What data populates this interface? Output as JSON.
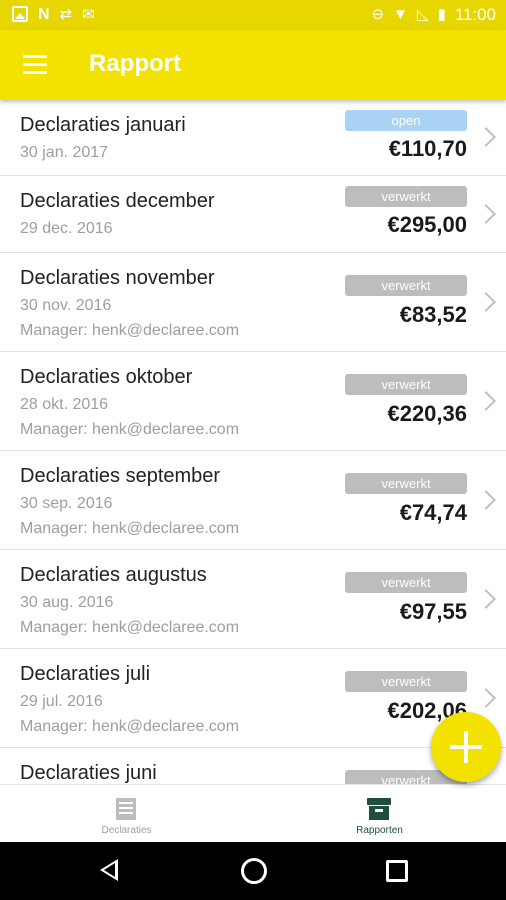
{
  "status_bar": {
    "time": "11:00",
    "left_icons": [
      "image-icon",
      "n-icon",
      "usb-icon",
      "mail-icon"
    ],
    "right_icons": [
      "dnd-icon",
      "wifi-icon",
      "no-signal-icon",
      "battery-icon"
    ]
  },
  "app_bar": {
    "title": "Rapport",
    "background": "#f3e200"
  },
  "reports": [
    {
      "title": "Declaraties januari",
      "date": "30 jan. 2017",
      "manager": "",
      "status": "open",
      "amount": "€110,70"
    },
    {
      "title": "Declaraties december",
      "date": "29 dec. 2016",
      "manager": "",
      "status": "verwerkt",
      "amount": "€295,00"
    },
    {
      "title": "Declaraties november",
      "date": "30 nov. 2016",
      "manager": "Manager: henk@declaree.com",
      "status": "verwerkt",
      "amount": "€83,52"
    },
    {
      "title": "Declaraties oktober",
      "date": "28 okt. 2016",
      "manager": "Manager: henk@declaree.com",
      "status": "verwerkt",
      "amount": "€220,36"
    },
    {
      "title": "Declaraties september",
      "date": "30 sep. 2016",
      "manager": "Manager: henk@declaree.com",
      "status": "verwerkt",
      "amount": "€74,74"
    },
    {
      "title": "Declaraties augustus",
      "date": "30 aug. 2016",
      "manager": "Manager: henk@declaree.com",
      "status": "verwerkt",
      "amount": "€97,55"
    },
    {
      "title": "Declaraties juli",
      "date": "29 jul. 2016",
      "manager": "Manager: henk@declaree.com",
      "status": "verwerkt",
      "amount": "€202,06"
    },
    {
      "title": "Declaraties juni",
      "date": "",
      "manager": "",
      "status": "verwerkt",
      "amount": ""
    }
  ],
  "tabs": [
    {
      "label": "Declaraties",
      "icon": "document-icon",
      "active": false
    },
    {
      "label": "Rapporten",
      "icon": "archive-box-icon",
      "active": true
    }
  ],
  "colors": {
    "accent": "#f3e200",
    "status_open": "#a9d2f5",
    "status_processed": "#bdbdbd",
    "active_tab": "#1f4e3d"
  }
}
